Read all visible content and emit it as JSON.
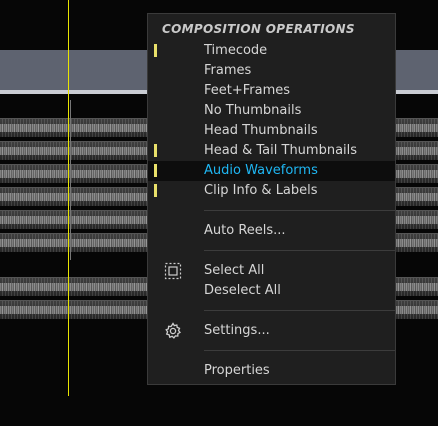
{
  "menu": {
    "header": "COMPOSITION OPERATIONS",
    "items": [
      {
        "label": "Timecode"
      },
      {
        "label": "Frames"
      },
      {
        "label": "Feet+Frames"
      },
      {
        "label": "No Thumbnails"
      },
      {
        "label": "Head Thumbnails"
      },
      {
        "label": "Head & Tail Thumbnails"
      },
      {
        "label": "Audio Waveforms"
      },
      {
        "label": "Clip Info & Labels"
      },
      {
        "label": "Auto Reels..."
      },
      {
        "label": "Select All"
      },
      {
        "label": "Deselect All"
      },
      {
        "label": "Settings..."
      },
      {
        "label": "Properties"
      }
    ],
    "checked_items": [
      "Timecode",
      "Head & Tail Thumbnails",
      "Audio Waveforms",
      "Clip Info & Labels"
    ],
    "highlighted_item": "Audio Waveforms"
  },
  "colors": {
    "highlight_text": "#1fb6f2",
    "check_mark": "#e9e06a",
    "playhead": "#e8e400"
  },
  "icons": {
    "select_all": "selection-frame-icon",
    "settings": "gear-icon"
  }
}
